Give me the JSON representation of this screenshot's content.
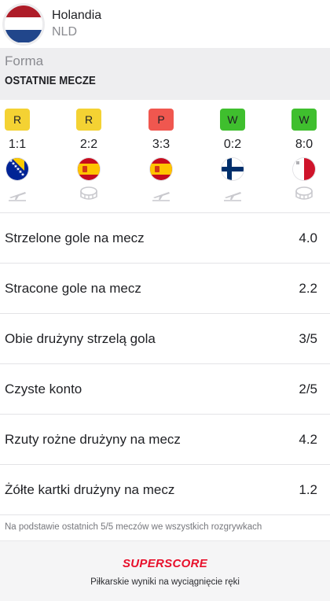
{
  "team": {
    "name": "Holandia",
    "code": "NLD",
    "flag_colors": [
      "#ae1c28",
      "#ffffff",
      "#21468b"
    ]
  },
  "form": {
    "section_label": "Forma",
    "title": "OSTATNIE MECZE",
    "matches": [
      {
        "result": "R",
        "result_color": "#f4d233",
        "score": "1:1",
        "opponent_flag": "bosnia-flag-icon",
        "venue": "away-plane-icon"
      },
      {
        "result": "R",
        "result_color": "#f4d233",
        "score": "2:2",
        "opponent_flag": "spain-flag-icon",
        "venue": "home-stadium-icon"
      },
      {
        "result": "P",
        "result_color": "#f0574f",
        "score": "3:3",
        "opponent_flag": "spain-flag-icon",
        "venue": "away-plane-icon"
      },
      {
        "result": "W",
        "result_color": "#3fbf2e",
        "score": "0:2",
        "opponent_flag": "finland-flag-icon",
        "venue": "away-plane-icon"
      },
      {
        "result": "W",
        "result_color": "#3fbf2e",
        "score": "8:0",
        "opponent_flag": "malta-flag-icon",
        "venue": "home-stadium-icon"
      }
    ]
  },
  "stats": [
    {
      "label": "Strzelone gole na mecz",
      "value": "4.0"
    },
    {
      "label": "Stracone gole na mecz",
      "value": "2.2"
    },
    {
      "label": "Obie drużyny strzelą gola",
      "value": "3/5"
    },
    {
      "label": "Czyste konto",
      "value": "2/5"
    },
    {
      "label": "Rzuty rożne drużyny na mecz",
      "value": "4.2"
    },
    {
      "label": "Żółte kartki drużyny na mecz",
      "value": "1.2"
    }
  ],
  "footnote": "Na podstawie ostatnich 5/5 meczów we wszystkich rozgrywkach",
  "promo": {
    "brand": "SUPERSCORE",
    "brand_color": "#e8102b",
    "tagline": "Piłkarskie wyniki na wyciągnięcie ręki"
  }
}
